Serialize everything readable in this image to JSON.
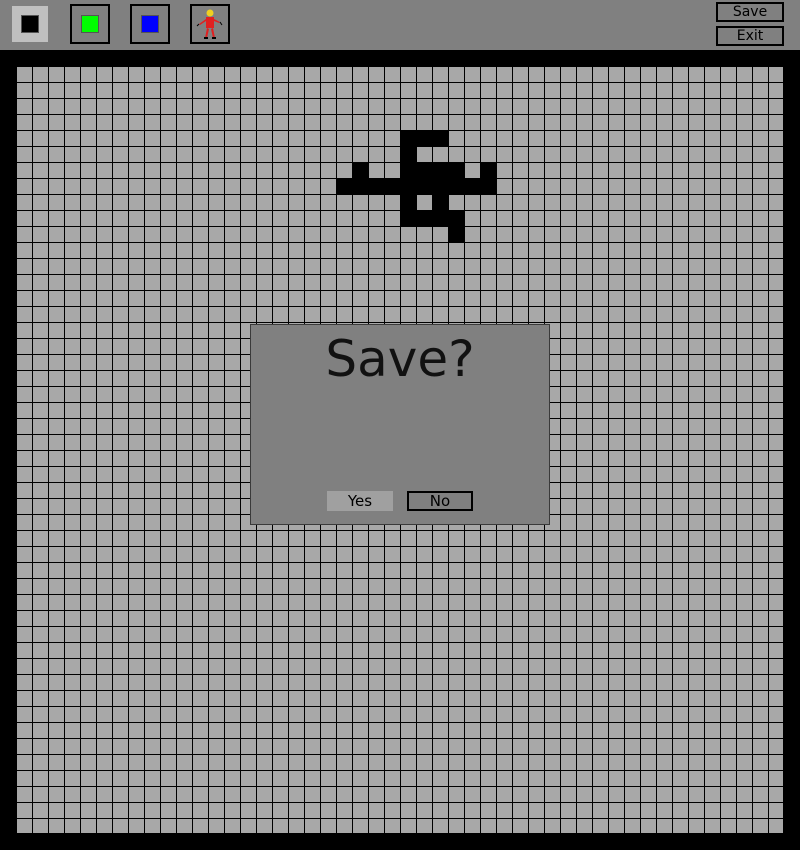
{
  "toolbar": {
    "tools": [
      {
        "name": "black",
        "color": "#000000",
        "selected": true
      },
      {
        "name": "green",
        "color": "#00ff00",
        "selected": false
      },
      {
        "name": "blue",
        "color": "#0000ff",
        "selected": false
      },
      {
        "name": "character",
        "icon": "person-sprite-icon",
        "selected": false
      }
    ],
    "save_label": "Save",
    "exit_label": "Exit"
  },
  "canvas": {
    "columns": 48,
    "rows": 48,
    "background_color": "#a8a8a8",
    "grid_line_color": "#000000",
    "filled_cells": [
      [
        24,
        4
      ],
      [
        25,
        4
      ],
      [
        26,
        4
      ],
      [
        24,
        5
      ],
      [
        21,
        6
      ],
      [
        24,
        6
      ],
      [
        25,
        6
      ],
      [
        26,
        6
      ],
      [
        27,
        6
      ],
      [
        29,
        6
      ],
      [
        20,
        7
      ],
      [
        21,
        7
      ],
      [
        22,
        7
      ],
      [
        23,
        7
      ],
      [
        24,
        7
      ],
      [
        25,
        7
      ],
      [
        26,
        7
      ],
      [
        27,
        7
      ],
      [
        28,
        7
      ],
      [
        29,
        7
      ],
      [
        24,
        8
      ],
      [
        26,
        8
      ],
      [
        24,
        9
      ],
      [
        25,
        9
      ],
      [
        26,
        9
      ],
      [
        27,
        9
      ],
      [
        27,
        10
      ]
    ],
    "fill_color": "#000000"
  },
  "dialog": {
    "title": "Save?",
    "yes_label": "Yes",
    "no_label": "No"
  }
}
